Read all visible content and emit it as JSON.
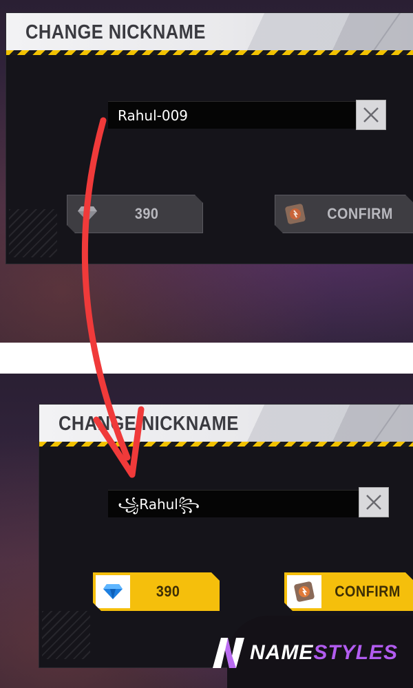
{
  "screens": [
    {
      "title": "CHANGE NICKNAME",
      "nickname": "Rahul-009",
      "price": "390",
      "confirm_label": "CONFIRM",
      "button_style": "disabled-gray"
    },
    {
      "title": "CHANGE NICKNAME",
      "nickname": "꧁Rahul꧂",
      "price": "390",
      "confirm_label": "CONFIRM",
      "button_style": "active-yellow"
    }
  ],
  "icons": {
    "clear": "close-icon",
    "currency": "diamond-icon",
    "confirm": "name-change-card-icon"
  },
  "colors": {
    "accent_yellow": "#f5bf0c",
    "arrow_red": "#f03a3a",
    "brand_purple": "#b25cf0",
    "panel_bg": "#15141a"
  },
  "watermark": {
    "logo_letter": "N",
    "word1": "NAME",
    "word2": "STYLES"
  }
}
